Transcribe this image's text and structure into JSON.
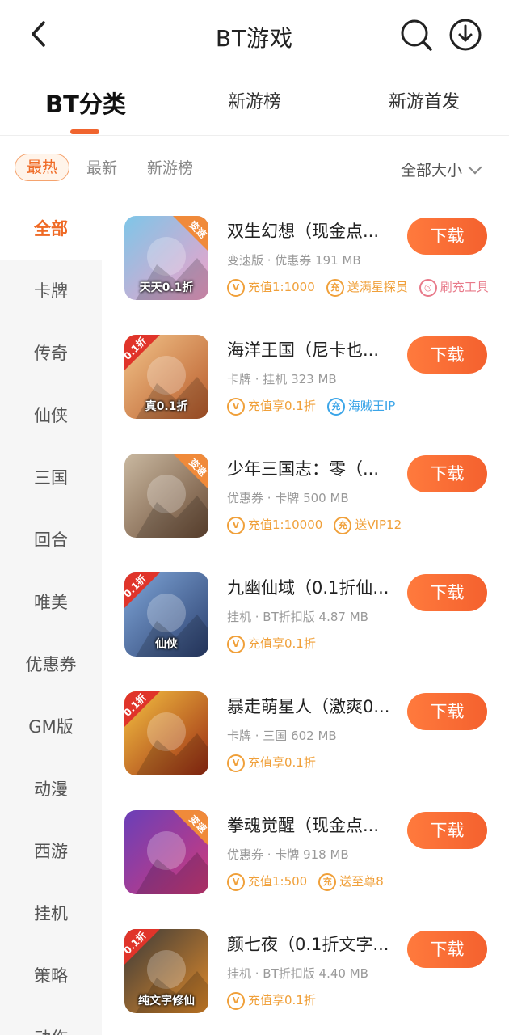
{
  "header": {
    "title": "BT游戏"
  },
  "tabs": [
    {
      "label": "BT分类",
      "active": true
    },
    {
      "label": "新游榜",
      "active": false
    },
    {
      "label": "新游首发",
      "active": false
    }
  ],
  "filters": {
    "items": [
      {
        "label": "最热",
        "active": true
      },
      {
        "label": "最新",
        "active": false
      },
      {
        "label": "新游榜",
        "active": false
      }
    ],
    "size_select": "全部大小"
  },
  "sidebar": {
    "items": [
      {
        "label": "全部",
        "active": true
      },
      {
        "label": "卡牌"
      },
      {
        "label": "传奇"
      },
      {
        "label": "仙侠"
      },
      {
        "label": "三国"
      },
      {
        "label": "回合"
      },
      {
        "label": "唯美"
      },
      {
        "label": "优惠券"
      },
      {
        "label": "GM版"
      },
      {
        "label": "动漫"
      },
      {
        "label": "西游"
      },
      {
        "label": "挂机"
      },
      {
        "label": "策略"
      },
      {
        "label": "动作"
      }
    ]
  },
  "colors": {
    "accent": "#f0642e",
    "tag_orange": "#f0a03a",
    "tag_blue": "#3ba5e8",
    "tag_pink": "#e87a8a"
  },
  "games": [
    {
      "name": "双生幻想（现金点...",
      "meta": "变速版 · 优惠券  191 MB",
      "button": "下载",
      "icon_badge": "变速",
      "icon_text": "天天0.1折",
      "icon_colors": [
        "#7ec6e8",
        "#f3a0c8"
      ],
      "tags": [
        {
          "icon": "V",
          "text": "充值1:1000",
          "color": "orange"
        },
        {
          "icon": "充",
          "text": "送满星探员",
          "color": "orange"
        },
        {
          "icon": "◎",
          "text": "刷充工具",
          "color": "pink"
        }
      ]
    },
    {
      "name": "海洋王国（尼卡也...",
      "meta": "卡牌 · 挂机  323 MB",
      "button": "下载",
      "icon_badge": "0.1折",
      "icon_text": "真0.1折",
      "icon_colors": [
        "#f2c48a",
        "#b85a2a"
      ],
      "tags": [
        {
          "icon": "V",
          "text": "充值享0.1折",
          "color": "orange"
        },
        {
          "icon": "充",
          "text": "海贼王IP",
          "color": "blue"
        }
      ]
    },
    {
      "name": "少年三国志：零（...",
      "meta": "优惠券 · 卡牌  500 MB",
      "button": "下载",
      "icon_badge": "变速",
      "icon_text": "",
      "icon_colors": [
        "#c9b8a0",
        "#6a4b35"
      ],
      "tags": [
        {
          "icon": "V",
          "text": "充值1:10000",
          "color": "orange"
        },
        {
          "icon": "充",
          "text": "送VIP12",
          "color": "orange"
        }
      ]
    },
    {
      "name": "九幽仙域（0.1折仙...",
      "meta": "挂机 · BT折扣版  4.87 MB",
      "button": "下载",
      "icon_badge": "0.1折",
      "icon_text": "仙侠",
      "icon_colors": [
        "#7fa6d8",
        "#2b3f6e"
      ],
      "tags": [
        {
          "icon": "V",
          "text": "充值享0.1折",
          "color": "orange"
        }
      ]
    },
    {
      "name": "暴走萌星人（激爽0...",
      "meta": "卡牌 · 三国  602 MB",
      "button": "下载",
      "icon_badge": "0.1折",
      "icon_text": "",
      "icon_colors": [
        "#f5c242",
        "#9a2a12"
      ],
      "tags": [
        {
          "icon": "V",
          "text": "充值享0.1折",
          "color": "orange"
        }
      ]
    },
    {
      "name": "拳魂觉醒（现金点...",
      "meta": "优惠券 · 卡牌  918 MB",
      "button": "下载",
      "icon_badge": "变速",
      "icon_text": "",
      "icon_colors": [
        "#6a3fb8",
        "#d23a7a"
      ],
      "tags": [
        {
          "icon": "V",
          "text": "充值1:500",
          "color": "orange"
        },
        {
          "icon": "充",
          "text": "送至尊8",
          "color": "orange"
        }
      ]
    },
    {
      "name": "颜七夜（0.1折文字...",
      "meta": "挂机 · BT折扣版  4.40 MB",
      "button": "下载",
      "icon_badge": "0.1折",
      "icon_text": "纯文字修仙",
      "icon_colors": [
        "#3a3a3a",
        "#e08a2a"
      ],
      "tags": [
        {
          "icon": "V",
          "text": "充值享0.1折",
          "color": "orange"
        }
      ]
    }
  ]
}
